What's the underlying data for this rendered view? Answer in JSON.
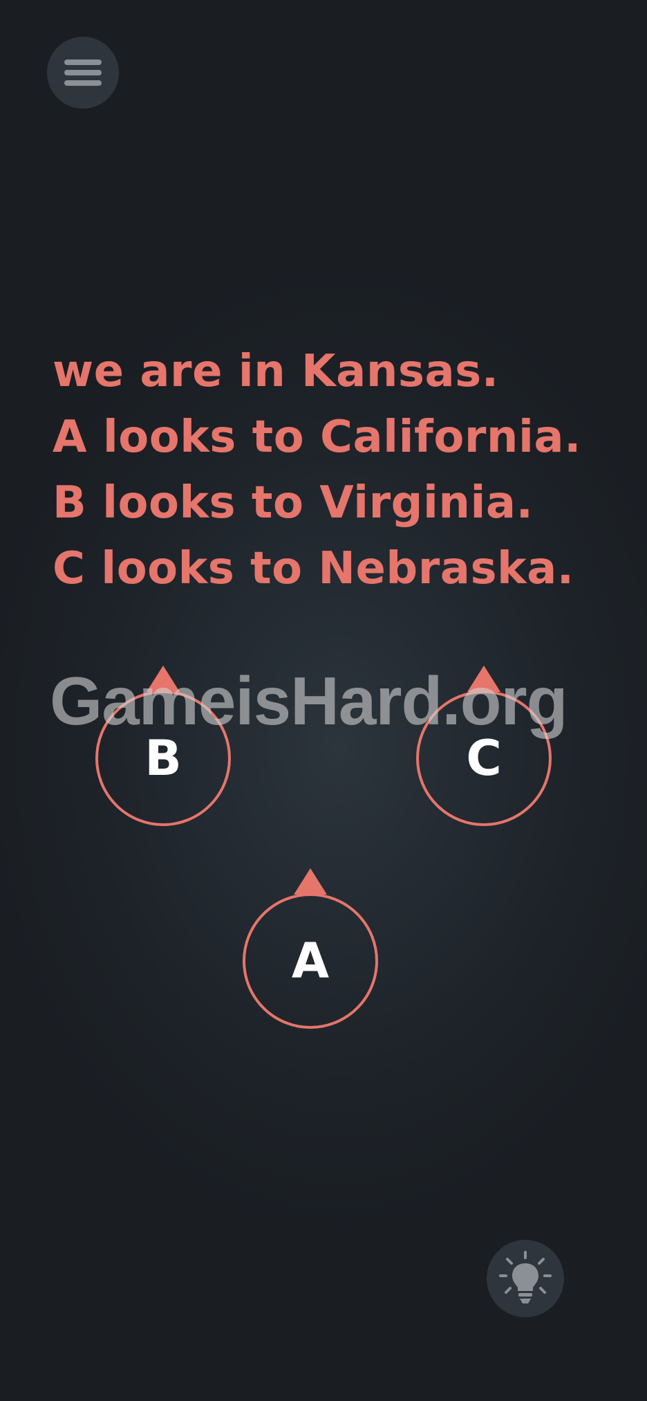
{
  "menu": {
    "icon": "hamburger-menu-icon"
  },
  "puzzle": {
    "lines": [
      "we are in Kansas.",
      "A looks to California.",
      "B looks to Virginia.",
      "C looks to Nebraska."
    ]
  },
  "nodes": {
    "a": {
      "label": "A"
    },
    "b": {
      "label": "B"
    },
    "c": {
      "label": "C"
    }
  },
  "watermark": {
    "text": "GameisHard.org"
  },
  "hint": {
    "icon": "lightbulb-icon"
  },
  "colors": {
    "accent": "#e6756b",
    "background": "#1d2228",
    "button_background": "#2e353d",
    "icon": "#8b9096"
  }
}
